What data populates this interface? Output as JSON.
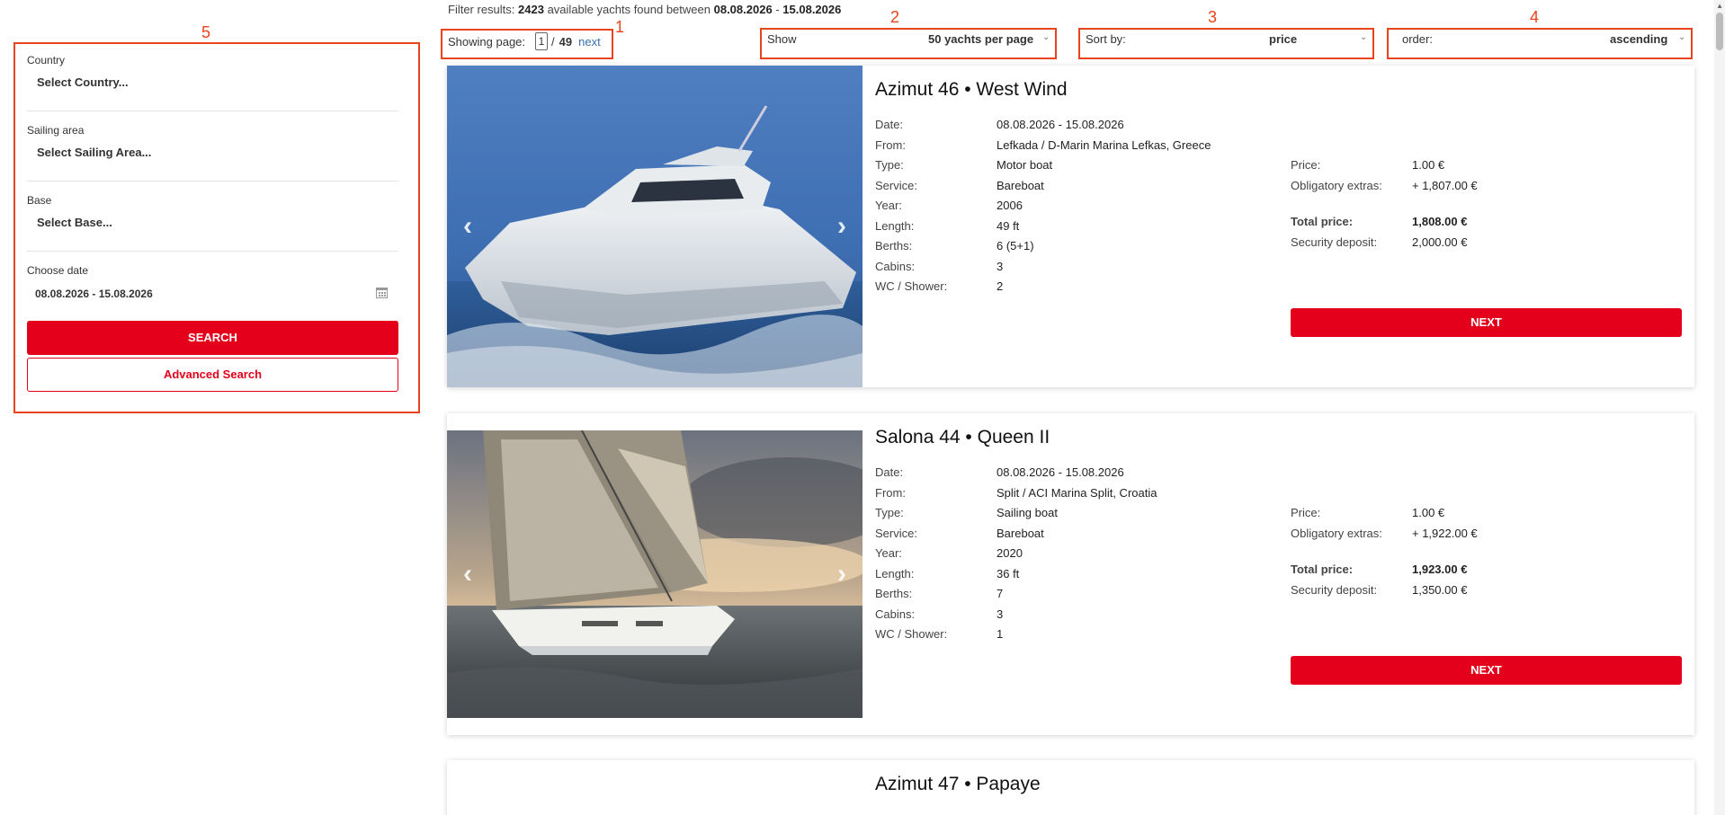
{
  "annotations": [
    "1",
    "2",
    "3",
    "4",
    "5"
  ],
  "filter_bar": {
    "prefix": "Filter results:",
    "count": "2423",
    "middle": "available yachts found between",
    "date_from": "08.08.2026",
    "dash": "-",
    "date_to": "15.08.2026"
  },
  "pager": {
    "label": "Showing page:",
    "current": "1",
    "slash": "/",
    "total": "49",
    "next": "next"
  },
  "show_select": {
    "label": "Show",
    "value": "50 yachts per page"
  },
  "sort_select": {
    "label": "Sort by:",
    "value": "price"
  },
  "order_select": {
    "label": "order:",
    "value": "ascending"
  },
  "sidebar": {
    "country": {
      "label": "Country",
      "value": "Select Country..."
    },
    "area": {
      "label": "Sailing area",
      "value": "Select Sailing Area..."
    },
    "base": {
      "label": "Base",
      "value": "Select Base..."
    },
    "date": {
      "label": "Choose date",
      "value": "08.08.2026 - 15.08.2026"
    },
    "search_label": "SEARCH",
    "advanced_label": "Advanced Search"
  },
  "spec_labels": {
    "date": "Date:",
    "from": "From:",
    "type": "Type:",
    "service": "Service:",
    "year": "Year:",
    "length": "Length:",
    "berths": "Berths:",
    "cabins": "Cabins:",
    "wc": "WC / Shower:",
    "price": "Price:",
    "extras": "Obligatory extras:",
    "total": "Total price:",
    "deposit": "Security deposit:"
  },
  "next_label": "NEXT",
  "yachts": [
    {
      "title": "Azimut 46 • West Wind",
      "date": "08.08.2026 - 15.08.2026",
      "from": "Lefkada / D-Marin Marina Lefkas, Greece",
      "type": "Motor boat",
      "service": "Bareboat",
      "year": "2006",
      "length": "49 ft",
      "berths": "6 (5+1)",
      "cabins": "3",
      "wc": "2",
      "price": "1.00 €",
      "extras": "+ 1,807.00 €",
      "total": "1,808.00 €",
      "deposit": "2,000.00 €"
    },
    {
      "title": "Salona 44 • Queen II",
      "date": "08.08.2026 - 15.08.2026",
      "from": "Split / ACI Marina Split, Croatia",
      "type": "Sailing boat",
      "service": "Bareboat",
      "year": "2020",
      "length": "36 ft",
      "berths": "7",
      "cabins": "3",
      "wc": "1",
      "price": "1.00 €",
      "extras": "+ 1,922.00 €",
      "total": "1,923.00 €",
      "deposit": "1,350.00 €"
    },
    {
      "title": "Azimut 47 • Papaye"
    }
  ],
  "colors": {
    "brand_red": "#e4001b",
    "annotation": "#e8431a",
    "link": "#3a6fb0"
  }
}
